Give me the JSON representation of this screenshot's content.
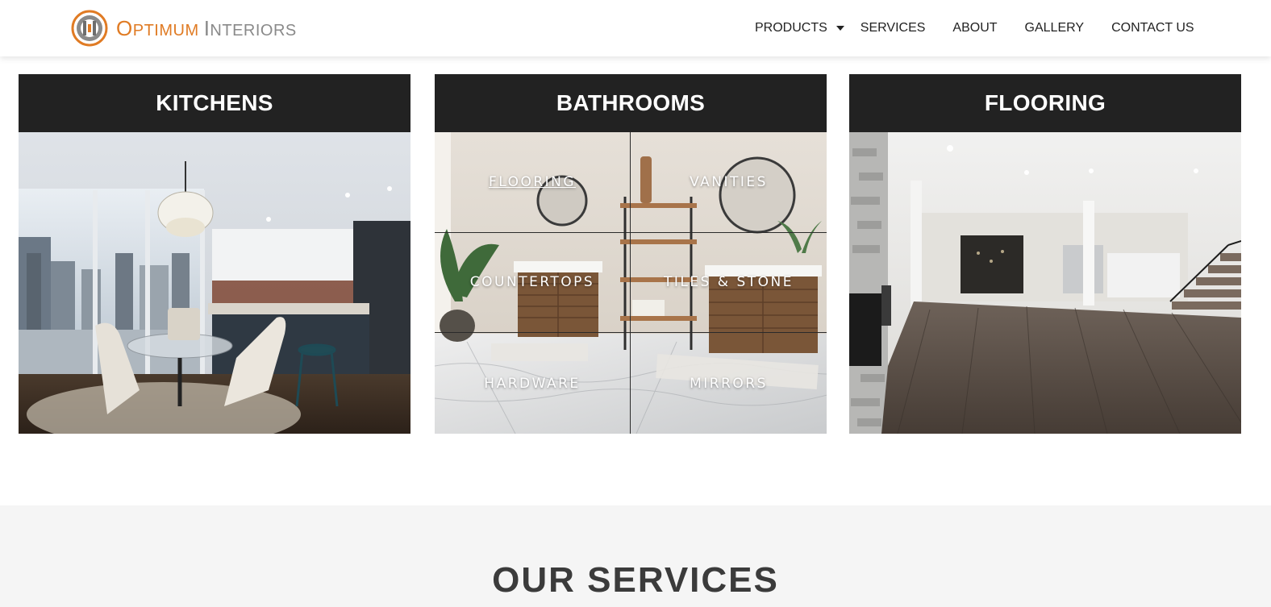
{
  "brand": {
    "word1_initial": "O",
    "word1_rest": "PTIMUM",
    "word2_initial": "I",
    "word2_rest": "NTERIORS",
    "primary_color": "#e07b24",
    "secondary_color": "#8a8a8a"
  },
  "nav": {
    "items": [
      {
        "label": "PRODUCTS",
        "has_dropdown": true
      },
      {
        "label": "SERVICES"
      },
      {
        "label": "ABOUT"
      },
      {
        "label": "GALLERY"
      },
      {
        "label": "CONTACT US"
      }
    ]
  },
  "cards": {
    "kitchens": {
      "title": "KITCHENS"
    },
    "bathrooms": {
      "title": "BATHROOMS",
      "links": [
        "FLOORING",
        "VANITIES",
        "COUNTERTOPS",
        "TILES & STONE",
        "HARDWARE",
        "MIRRORS"
      ]
    },
    "flooring": {
      "title": "FLOORING"
    }
  },
  "services": {
    "title": "OUR SERVICES"
  },
  "colors": {
    "card_header_bg": "#222222",
    "services_bg": "#f5f5f5"
  }
}
